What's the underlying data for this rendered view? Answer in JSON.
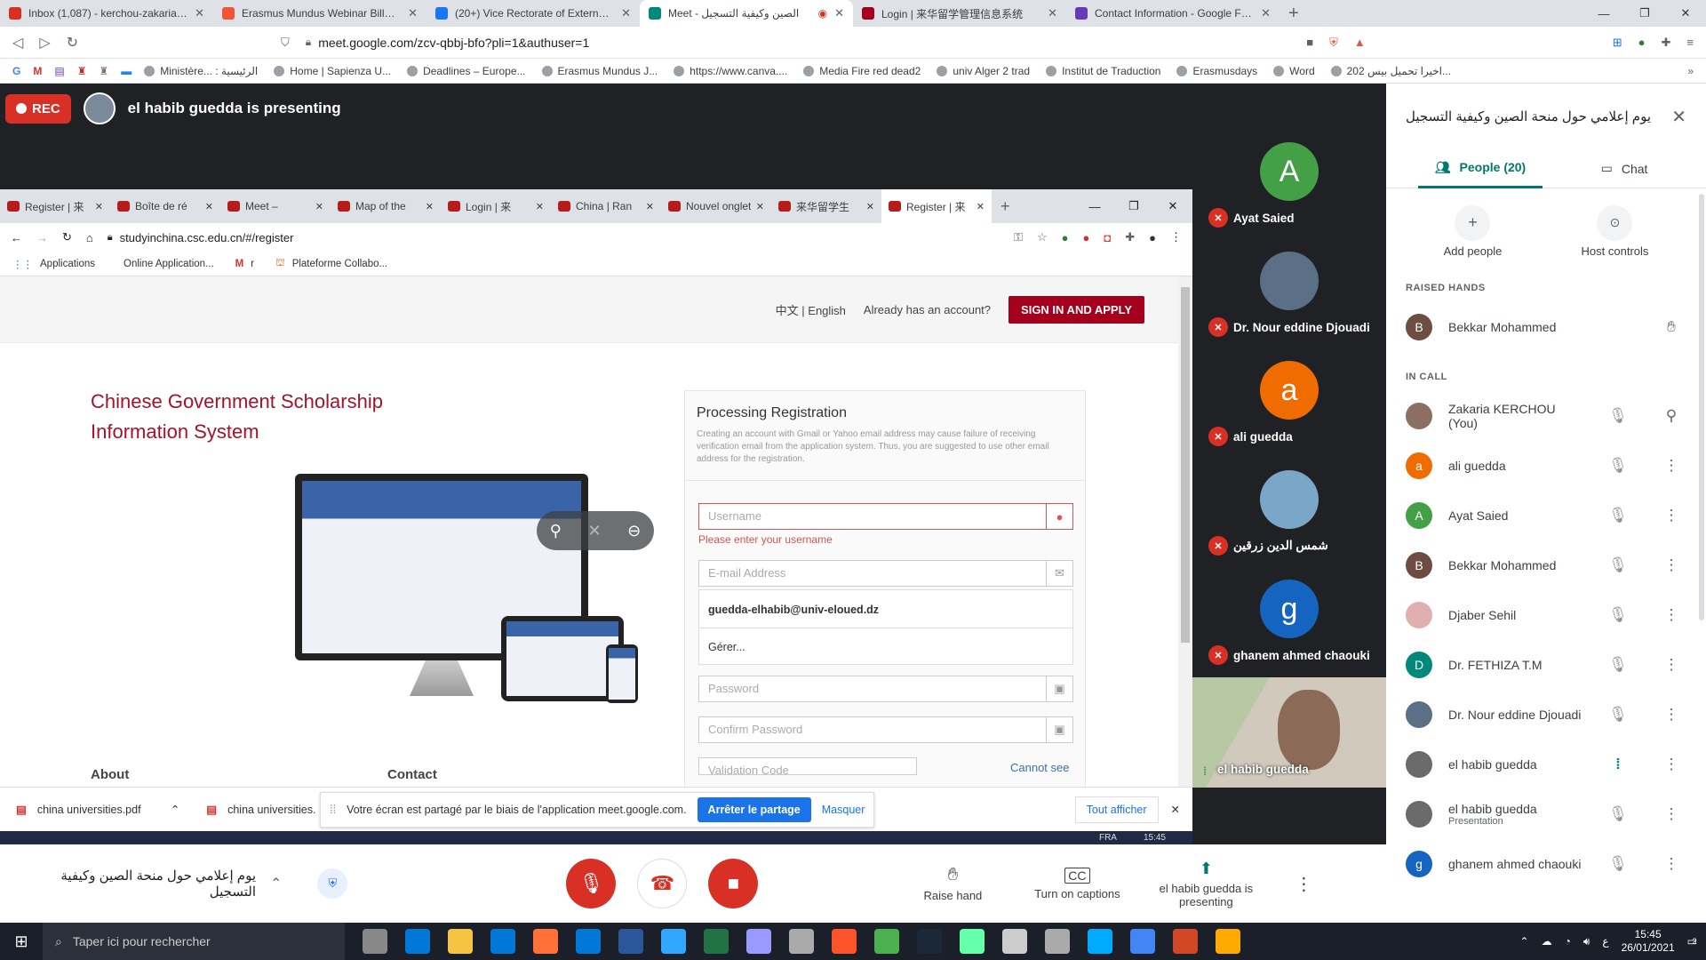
{
  "browser": {
    "tabs": [
      {
        "label": "Inbox (1,087) - kerchou-zakaria@univ-",
        "color": "#d93025",
        "active": false
      },
      {
        "label": "Erasmus Mundus Webinar Billets, Date",
        "color": "#f05537",
        "active": false
      },
      {
        "label": "(20+) Vice Rectorate of External Relati",
        "color": "#1877f2",
        "active": false
      },
      {
        "label": "Meet - الصين وكيفية التسجيل",
        "color": "#00897b",
        "active": true
      },
      {
        "label": "Login | 来华留学管理信息系统",
        "color": "#a4001d",
        "active": false
      },
      {
        "label": "Contact Information - Google Forms",
        "color": "#673ab7",
        "active": false
      }
    ],
    "url": "meet.google.com/zcv-qbbj-bfo?pli=1&authuser=1",
    "bookmarks": [
      "Ministère... : الرئيسية",
      "Home | Sapienza U...",
      "Deadlines – Europe...",
      "Erasmus Mundus J...",
      "https://www.canva....",
      "Media Fire red dead2",
      "univ Alger 2 trad",
      "Institut de Traduction",
      "Erasmusdays",
      "Word",
      "اخيرا تحميل بيس 202..."
    ]
  },
  "meet": {
    "rec_label": "REC",
    "presenter_text": "el habib guedda is presenting",
    "meeting_title": "يوم إعلامي حول منحة الصين وكيفية التسجيل",
    "tiles": [
      {
        "initial": "A",
        "name": "Ayat Saied",
        "color": "#43a047"
      },
      {
        "initial": "",
        "name": "Dr. Nour eddine Djouadi",
        "color": "#5b6f86"
      },
      {
        "initial": "a",
        "name": "ali guedda",
        "color": "#ef6c00"
      },
      {
        "initial": "",
        "name": "شمس الدين زرقين",
        "color": "#7aa7c8"
      },
      {
        "initial": "g",
        "name": "ghanem ahmed chaouki",
        "color": "#1565c0"
      }
    ],
    "self_tile_name": "el habib guedda"
  },
  "shared": {
    "tabs": [
      "Register | 来",
      "Boîte de ré",
      "Meet –",
      "Map of the",
      "Login | 来",
      "China | Ran",
      "Nouvel onglet",
      "来华留学生",
      "Register | 来"
    ],
    "url": "studyinchina.csc.edu.cn/#/register",
    "bookmarks": [
      "Applications",
      "Online Application...",
      "r",
      "Plateforme Collabo..."
    ],
    "lang": "中文 | English",
    "already": "Already has an account?",
    "signin": "SIGN IN AND APPLY",
    "title": "Chinese Government Scholarship Information System",
    "form_title": "Processing Registration",
    "form_note": "Creating an account with Gmail or Yahoo email address may cause failure of receiving verification email from the application system. Thus, you are suggested to use other email address for the registration.",
    "username_ph": "Username",
    "username_error": "Please enter your username",
    "email_ph": "E-mail Address",
    "suggestion": "guedda-elhabib@univ-eloued.dz",
    "manage": "Gérer...",
    "password_ph": "Password",
    "confirm_ph": "Confirm Password",
    "validation_ph": "Validation Code",
    "cannot_see": "Cannot see",
    "about": "About",
    "contact": "Contact",
    "downloads": [
      "china universities.pdf",
      "china universities."
    ],
    "share_msg": "Votre écran est partagé par le biais de l'application meet.google.com.",
    "stop_share": "Arrêter le partage",
    "hide": "Masquer",
    "show_all": "Tout afficher",
    "clock": "15:45",
    "taskbar_lang": "FRA"
  },
  "panel": {
    "people_tab": "People (20)",
    "chat_tab": "Chat",
    "add_people": "Add people",
    "host_controls": "Host controls",
    "raised_hands_label": "RAISED HANDS",
    "raised": [
      {
        "name": "Bekkar Mohammed",
        "initial": "B",
        "color": "#6d4c41"
      }
    ],
    "in_call_label": "IN CALL",
    "people": [
      {
        "name": "Zakaria KERCHOU (You)",
        "sub": "",
        "initial": "",
        "color": "#8d6e63",
        "icon": "pin"
      },
      {
        "name": "ali guedda",
        "sub": "",
        "initial": "a",
        "color": "#ef6c00",
        "icon": "more"
      },
      {
        "name": "Ayat Saied",
        "sub": "",
        "initial": "A",
        "color": "#43a047",
        "icon": "more"
      },
      {
        "name": "Bekkar Mohammed",
        "sub": "",
        "initial": "B",
        "color": "#6d4c41",
        "icon": "more"
      },
      {
        "name": "Djaber Sehil",
        "sub": "",
        "initial": "",
        "color": "#e0b0b0",
        "icon": "more"
      },
      {
        "name": "Dr. FETHIZA T.M",
        "sub": "",
        "initial": "D",
        "color": "#00897b",
        "icon": "more"
      },
      {
        "name": "Dr. Nour eddine Djouadi",
        "sub": "",
        "initial": "",
        "color": "#5b6f86",
        "icon": "more"
      },
      {
        "name": "el habib guedda",
        "sub": "",
        "initial": "",
        "color": "#6b6b6b",
        "icon": "more"
      },
      {
        "name": "el habib guedda",
        "sub": "Presentation",
        "initial": "",
        "color": "#6b6b6b",
        "icon": "more"
      },
      {
        "name": "ghanem ahmed chaouki",
        "sub": "",
        "initial": "g",
        "color": "#1565c0",
        "icon": "more"
      }
    ]
  },
  "controls": {
    "raise_hand": "Raise hand",
    "captions": "Turn on captions",
    "presenting": "el habib guedda is presenting"
  },
  "windows": {
    "search_ph": "Taper ici pour rechercher",
    "time": "15:45",
    "date": "26/01/2021",
    "notif": "2"
  }
}
